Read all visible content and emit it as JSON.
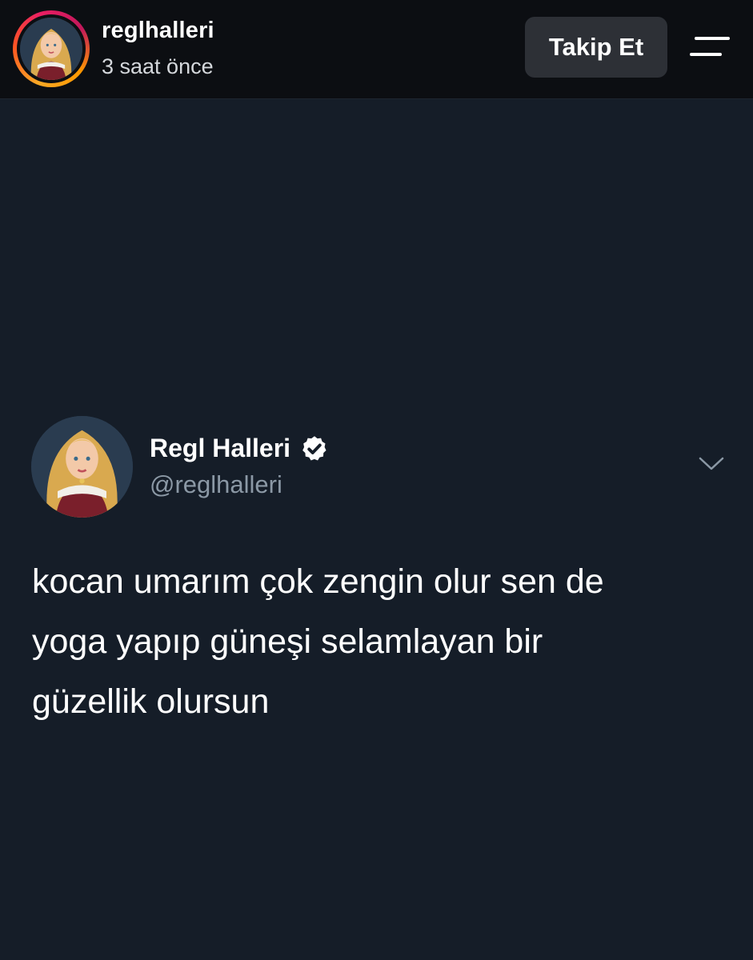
{
  "header": {
    "username": "reglhalleri",
    "timestamp": "3 saat önce",
    "follow_label": "Takip Et",
    "ring_colors": [
      "#f9a825",
      "#ff5722",
      "#e91e63"
    ]
  },
  "tweet": {
    "display_name": "Regl Halleri",
    "handle": "@reglhalleri",
    "verified": true,
    "text": "kocan umarım çok zengin olur sen de\nyoga yapıp güneşi selamlayan bir\ngüzellik olursun"
  },
  "icons": {
    "menu": "hamburger-menu-icon",
    "verified": "verified-badge-icon",
    "chevron": "chevron-down-icon"
  },
  "colors": {
    "background": "#151d28",
    "topbar": "#0c0e12",
    "button": "#2d3036",
    "handle_gray": "#8b98a5"
  }
}
